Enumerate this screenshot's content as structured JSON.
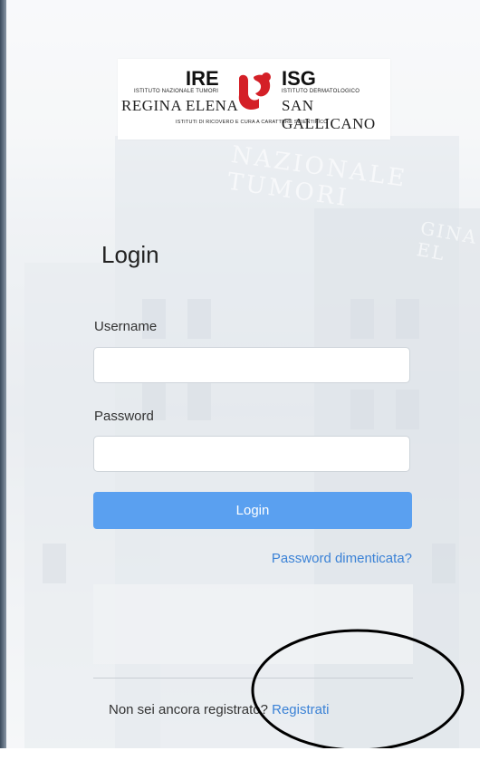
{
  "logo": {
    "left_acronym": "IRE",
    "left_small": "ISTITUTO NAZIONALE TUMORI",
    "left_name": "REGINA ELENA",
    "right_acronym": "ISG",
    "right_small": "ISTITUTO DERMATOLOGICO",
    "right_name": "SAN GALLICANO",
    "footer": "ISTITUTI DI RICOVERO E CURA A CARATTERE SCIENTIFICO"
  },
  "background": {
    "facade_text": "NAZIONALE TUMORI",
    "facade_text_2": "GINA EL"
  },
  "form": {
    "title": "Login",
    "username_label": "Username",
    "username_value": "",
    "password_label": "Password",
    "password_value": "",
    "login_button": "Login",
    "forgot_link": "Password dimenticata?",
    "register_prompt": "Non sei ancora registrato?",
    "register_link": "Registrati"
  },
  "colors": {
    "accent": "#5aa0f0",
    "link": "#3b82d6",
    "logo_red": "#d42027"
  },
  "icons": {
    "logo_mark": "ire-isg-logo-mark-icon"
  }
}
